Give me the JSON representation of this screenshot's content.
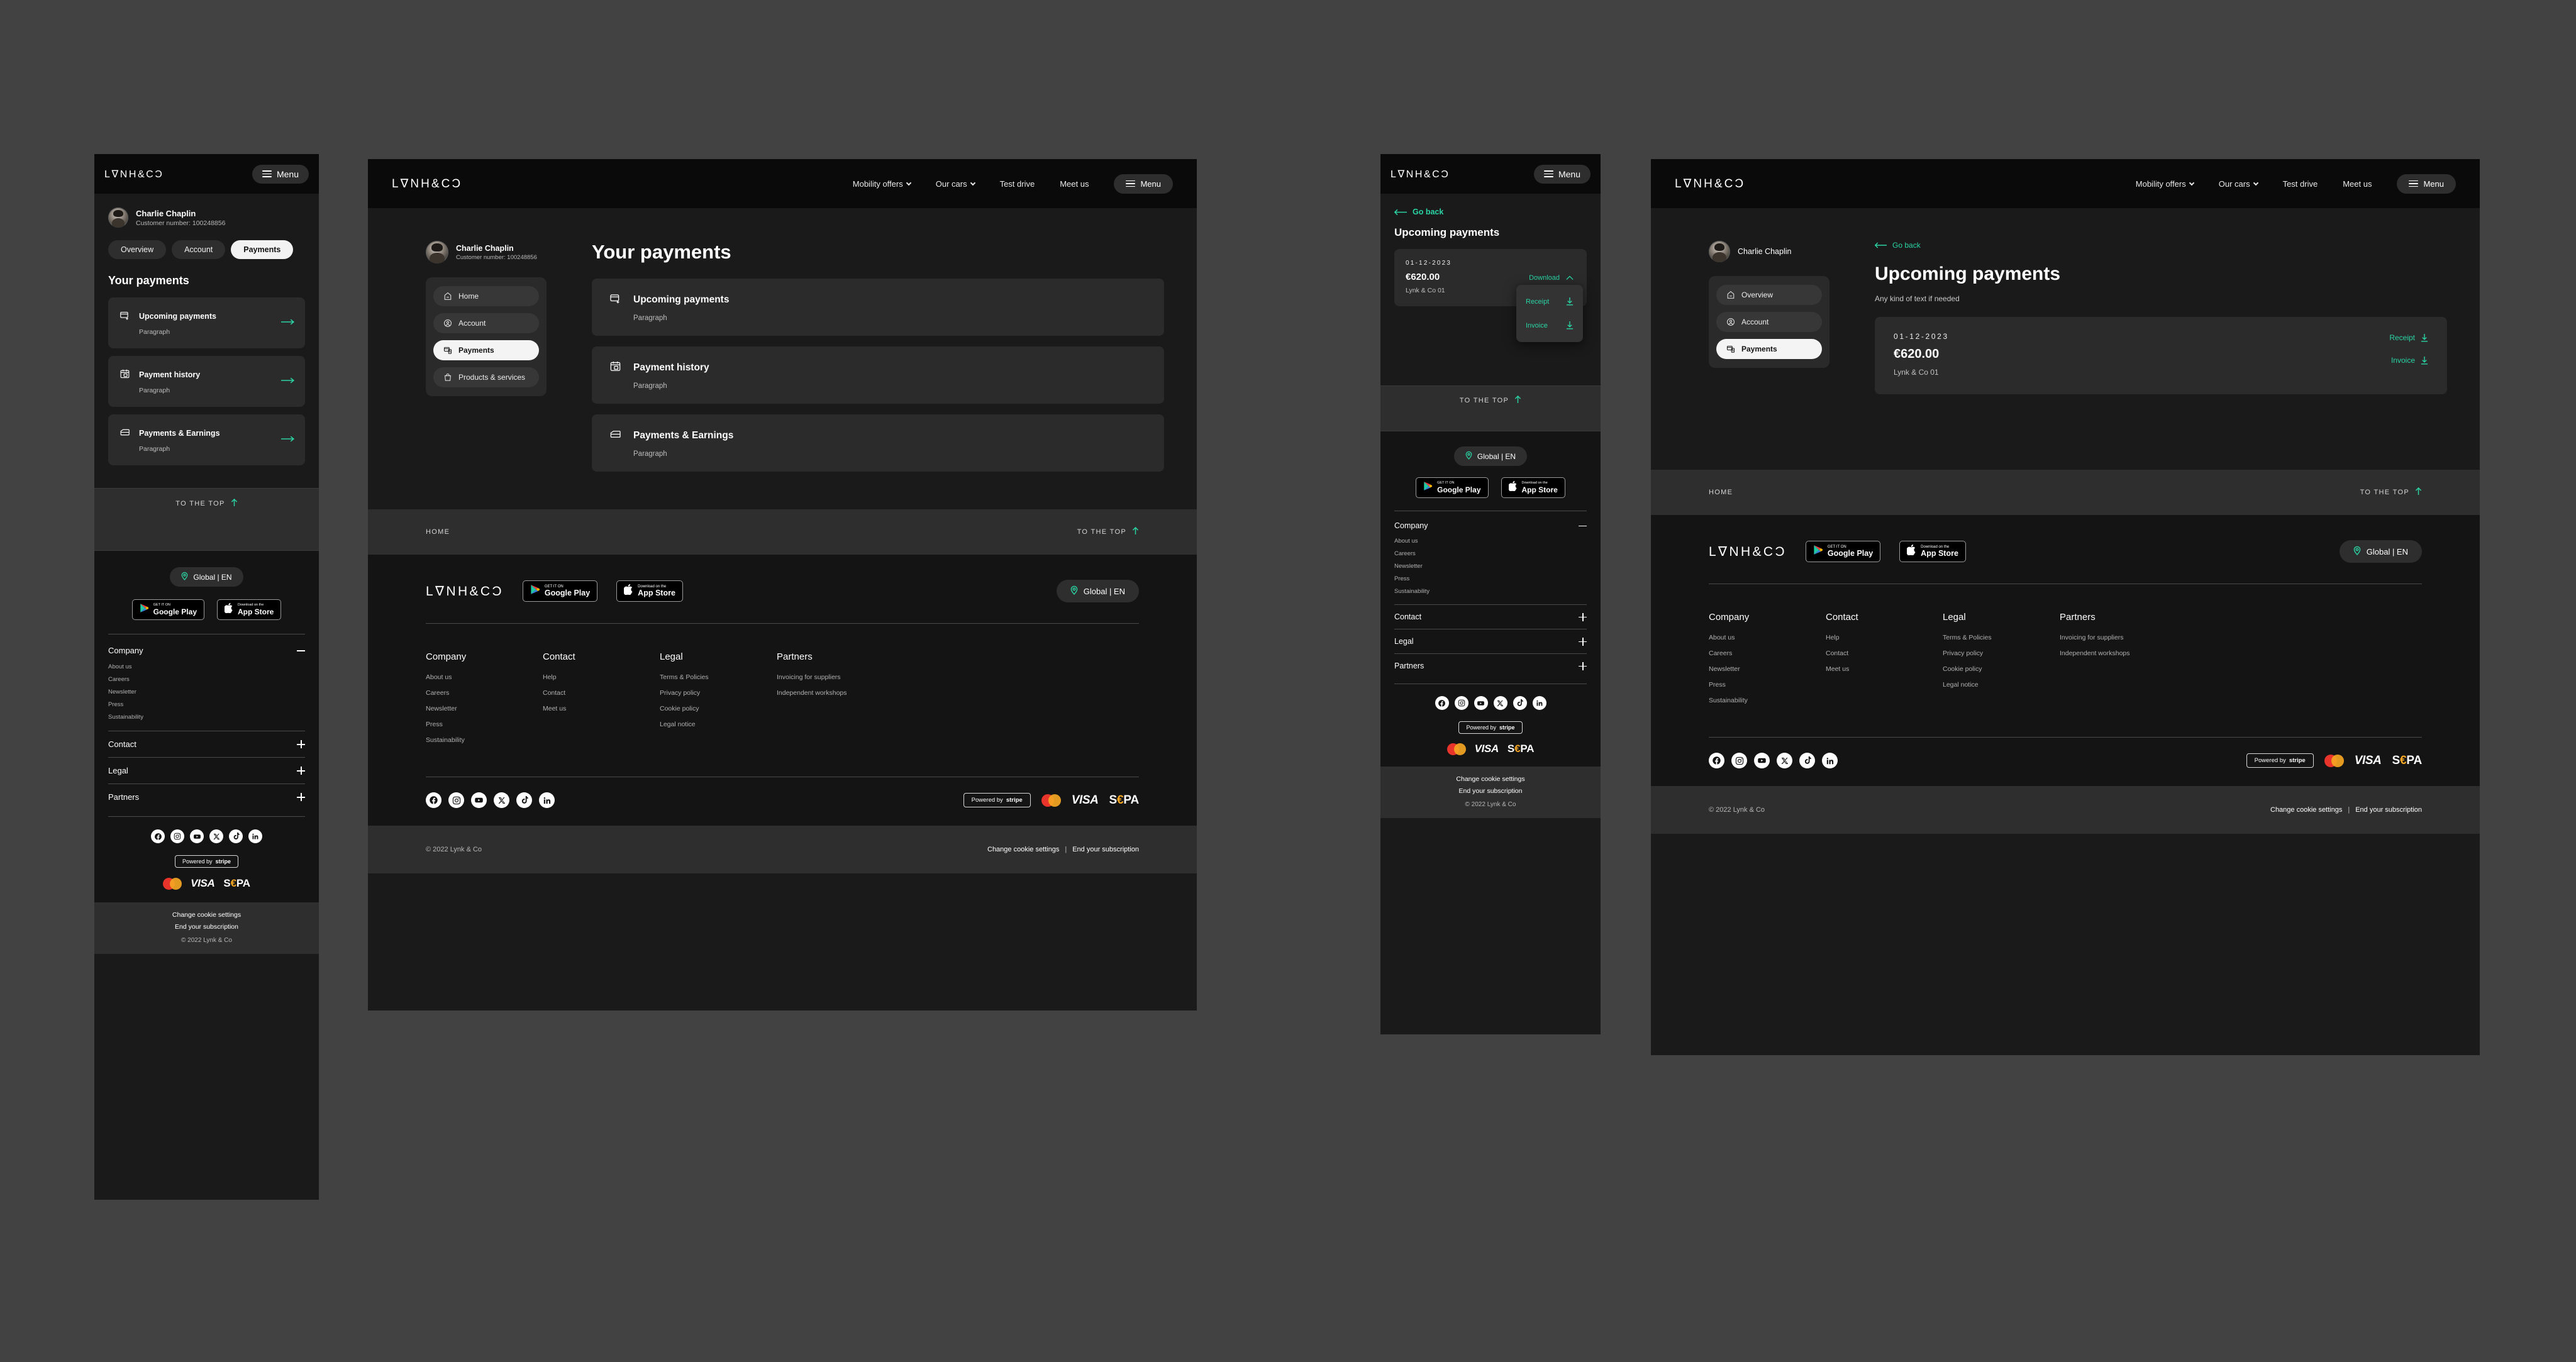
{
  "brand": {
    "logo": "L∇NH&CƆ",
    "logo_text": "LYNK&CO",
    "accent": "#2ad4a4",
    "copyright": "© 2022 Lynk & Co"
  },
  "topnav": {
    "items": [
      {
        "label": "Mobility offers",
        "has_chevron": true
      },
      {
        "label": "Our cars",
        "has_chevron": true
      },
      {
        "label": "Test drive",
        "has_chevron": false
      },
      {
        "label": "Meet us",
        "has_chevron": false
      }
    ],
    "menu_label": "Menu"
  },
  "user": {
    "name": "Charlie Chaplin",
    "customer_number_label": "Customer number: 100248856"
  },
  "mobile_tabs": [
    {
      "label": "Overview",
      "active": false
    },
    {
      "label": "Account",
      "active": false
    },
    {
      "label": "Payments",
      "active": true
    }
  ],
  "sidenav_full": [
    {
      "label": "Home",
      "icon": "home-icon",
      "active": false
    },
    {
      "label": "Account",
      "icon": "account-icon",
      "active": false
    },
    {
      "label": "Payments",
      "icon": "payments-icon",
      "active": true
    },
    {
      "label": "Products & services",
      "icon": "bag-icon",
      "active": false
    }
  ],
  "sidenav_short": [
    {
      "label": "Overview",
      "icon": "home-icon",
      "active": false
    },
    {
      "label": "Account",
      "icon": "account-icon",
      "active": false
    },
    {
      "label": "Payments",
      "icon": "payments-icon",
      "active": true
    }
  ],
  "payments_page": {
    "title": "Your payments",
    "cards": [
      {
        "title": "Upcoming payments",
        "paragraph": "Paragraph",
        "icon": "card-plus-icon"
      },
      {
        "title": "Payment history",
        "paragraph": "Paragraph",
        "icon": "calendar-lock-icon"
      },
      {
        "title": "Payments & Earnings",
        "paragraph": "Paragraph",
        "icon": "wallet-icon"
      }
    ]
  },
  "upcoming_page": {
    "go_back": "Go back",
    "title": "Upcoming payments",
    "subtitle": "Any kind of text if needed",
    "entry": {
      "date": "01-12-2023",
      "amount": "€620.00",
      "model": "Lynk & Co 01"
    },
    "download_label": "Download",
    "download_options": [
      {
        "label": "Receipt",
        "icon": "download-icon"
      },
      {
        "label": "Invoice",
        "icon": "download-icon"
      }
    ]
  },
  "to_top": {
    "label": "TO THE TOP",
    "icon": "arrow-up-icon"
  },
  "breadcrumb": {
    "home": "HOME"
  },
  "footer": {
    "region_button": "Global | EN",
    "stores": [
      {
        "sub": "GET IT ON",
        "main": "Google Play",
        "icon": "google-play-icon"
      },
      {
        "sub": "Download on the",
        "main": "App Store",
        "icon": "apple-icon"
      }
    ],
    "columns": [
      {
        "heading": "Company",
        "links": [
          "About us",
          "Careers",
          "Newsletter",
          "Press",
          "Sustainability"
        ]
      },
      {
        "heading": "Contact",
        "links": [
          "Help",
          "Contact",
          "Meet us"
        ]
      },
      {
        "heading": "Legal",
        "links": [
          "Terms & Policies",
          "Privacy policy",
          "Cookie policy",
          "Legal notice"
        ]
      },
      {
        "heading": "Partners",
        "links": [
          "Invoicing for suppliers",
          "Independent workshops"
        ]
      }
    ],
    "accordion": [
      {
        "heading": "Company",
        "state": "expanded",
        "icon": "minus-icon",
        "links": [
          "About us",
          "Careers",
          "Newsletter",
          "Press",
          "Sustainability"
        ]
      },
      {
        "heading": "Contact",
        "state": "collapsed",
        "icon": "plus-icon",
        "links": []
      },
      {
        "heading": "Legal",
        "state": "collapsed",
        "icon": "plus-icon",
        "links": []
      },
      {
        "heading": "Partners",
        "state": "collapsed",
        "icon": "plus-icon",
        "links": []
      }
    ],
    "social": [
      "facebook-icon",
      "instagram-icon",
      "youtube-icon",
      "x-icon",
      "tiktok-icon",
      "linkedin-icon"
    ],
    "payments": {
      "stripe_pre": "Powered by",
      "stripe_name": "stripe",
      "mastercard": "mastercard-icon",
      "visa": "VISA",
      "sepa_pre": "S",
      "sepa_euro": "€",
      "sepa_post": "PA"
    },
    "bottom_links": [
      "Change cookie settings",
      "End your subscription"
    ],
    "separator": "|"
  }
}
